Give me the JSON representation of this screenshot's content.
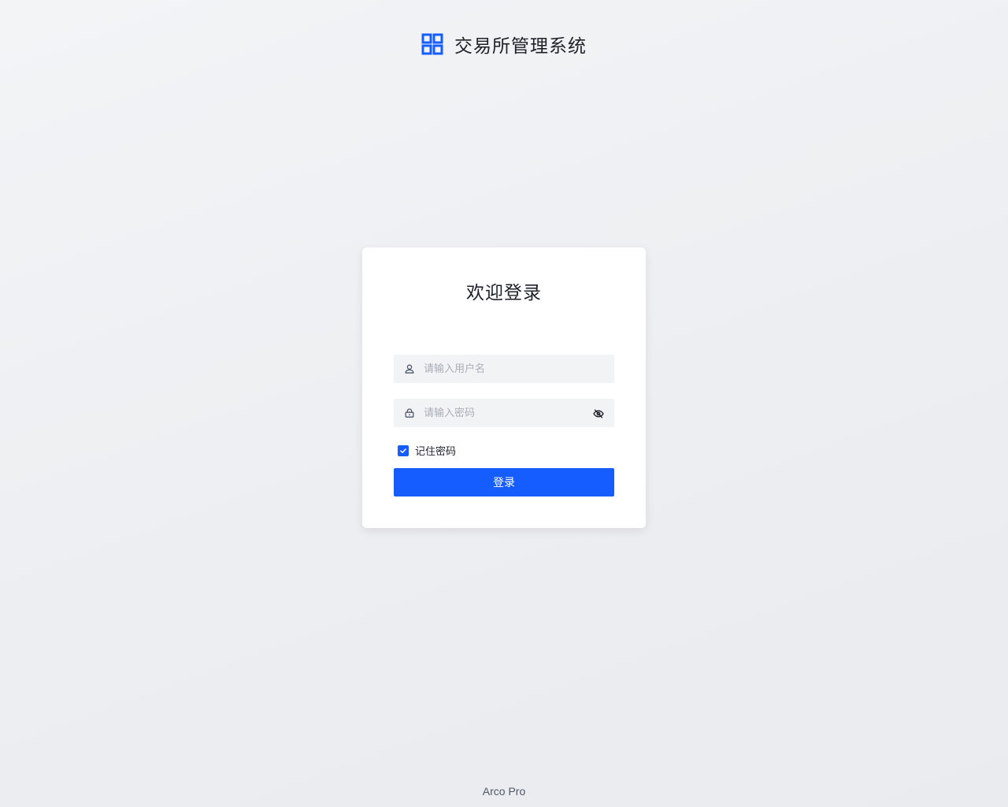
{
  "header": {
    "title": "交易所管理系统",
    "logo_icon": "grid-icon"
  },
  "login_card": {
    "title": "欢迎登录",
    "username": {
      "placeholder": "请输入用户名",
      "value": "",
      "icon": "user-icon"
    },
    "password": {
      "placeholder": "请输入密码",
      "value": "",
      "icon": "lock-icon",
      "toggle_icon": "eye-invisible-icon"
    },
    "remember": {
      "label": "记住密码",
      "checked": true
    },
    "submit_label": "登录"
  },
  "footer": {
    "text": "Arco Pro"
  },
  "colors": {
    "primary": "#165dff",
    "text": "#1d2129",
    "placeholder": "#a9aeb8",
    "field_bg": "#f2f3f5",
    "footer_text": "#4e5969"
  }
}
